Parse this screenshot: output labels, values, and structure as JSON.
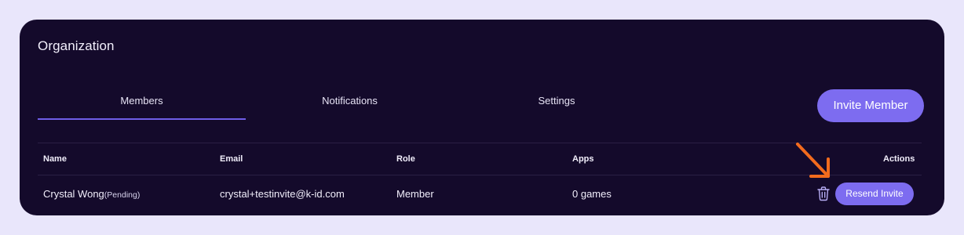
{
  "page": {
    "title": "Organization"
  },
  "tabs": [
    {
      "label": "Members",
      "active": true
    },
    {
      "label": "Notifications",
      "active": false
    },
    {
      "label": "Settings",
      "active": false
    }
  ],
  "invite_button": {
    "label": "Invite Member"
  },
  "table": {
    "headers": {
      "name": "Name",
      "email": "Email",
      "role": "Role",
      "apps": "Apps",
      "actions": "Actions"
    },
    "rows": [
      {
        "name": "Crystal Wong",
        "status": "(Pending)",
        "email": "crystal+testinvite@k-id.com",
        "role": "Member",
        "apps": "0 games",
        "resend_label": "Resend Invite",
        "delete_icon": "trash-icon"
      }
    ]
  },
  "annotation": {
    "icon": "arrow-down-right-icon",
    "color": "#f26b1d"
  },
  "colors": {
    "background": "#e9e6fb",
    "panel": "#140a2b",
    "accent": "#7d6cf0",
    "tab_underline": "#6f5ee8"
  }
}
